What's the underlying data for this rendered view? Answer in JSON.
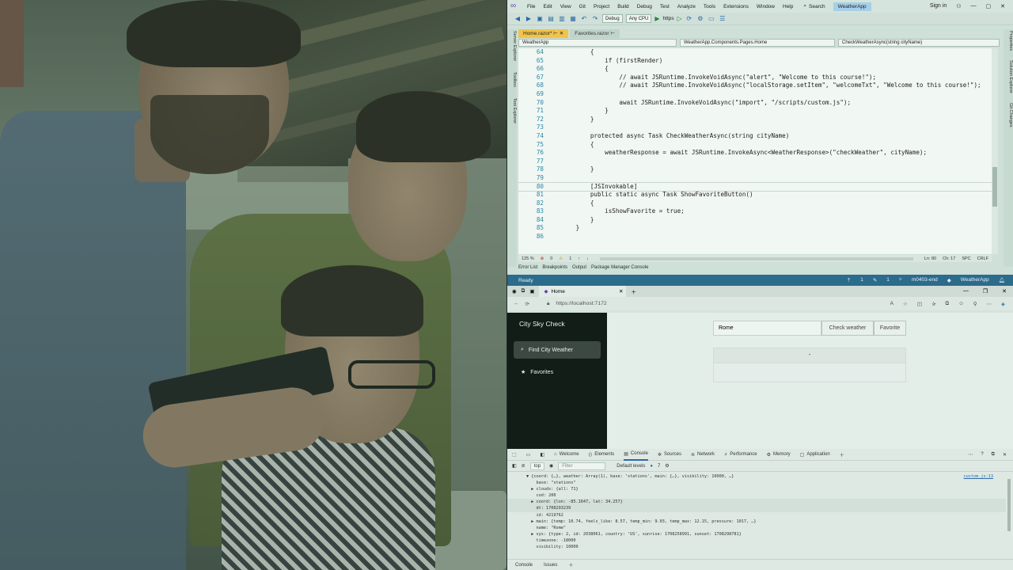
{
  "vs": {
    "menu": [
      "File",
      "Edit",
      "View",
      "Git",
      "Project",
      "Build",
      "Debug",
      "Test",
      "Analyze",
      "Tools",
      "Extensions",
      "Window",
      "Help"
    ],
    "search_label": "Search",
    "app_name": "WeatherApp",
    "sign_in": "Sign in",
    "toolbar": {
      "config": "Debug",
      "platform": "Any CPU",
      "run_target": "https"
    },
    "tabs": [
      {
        "label": "Home.razor*",
        "active": true
      },
      {
        "label": "Favorites.razor",
        "active": false
      }
    ],
    "nav": {
      "project": "WeatherApp",
      "class": "WeatherApp.Components.Pages.Home",
      "member": "CheckWeatherAsync(string cityName)"
    },
    "left_tools": [
      "Server Explorer",
      "Toolbox",
      "Test Explorer"
    ],
    "right_tools": [
      "Properties",
      "Solution Explorer",
      "Git Changes"
    ],
    "code": [
      {
        "n": "64",
        "t": "            {"
      },
      {
        "n": "65",
        "t": "                if (firstRender)"
      },
      {
        "n": "66",
        "t": "                {"
      },
      {
        "n": "67",
        "t": "                    // await JSRuntime.InvokeVoidAsync(\"alert\", \"Welcome to this course!\");"
      },
      {
        "n": "68",
        "t": "                    // await JSRuntime.InvokeVoidAsync(\"localStorage.setItem\", \"welcomeTxt\", \"Welcome to this course!\");"
      },
      {
        "n": "69",
        "t": ""
      },
      {
        "n": "70",
        "t": "                    await JSRuntime.InvokeVoidAsync(\"import\", \"/scripts/custom.js\");"
      },
      {
        "n": "71",
        "t": "                }"
      },
      {
        "n": "72",
        "t": "            }"
      },
      {
        "n": "73",
        "t": ""
      },
      {
        "n": "74",
        "t": "            protected async Task CheckWeatherAsync(string cityName)"
      },
      {
        "n": "75",
        "t": "            {"
      },
      {
        "n": "76",
        "t": "                weatherResponse = await JSRuntime.InvokeAsync<WeatherResponse>(\"checkWeather\", cityName);"
      },
      {
        "n": "77",
        "t": ""
      },
      {
        "n": "78",
        "t": "            }"
      },
      {
        "n": "79",
        "t": ""
      },
      {
        "n": "80",
        "t": "            [JSInvokable]"
      },
      {
        "n": "81",
        "t": "            public static async Task ShowFavoriteButton()"
      },
      {
        "n": "82",
        "t": "            {"
      },
      {
        "n": "83",
        "t": "                isShowFavorite = true;"
      },
      {
        "n": "84",
        "t": "            }"
      },
      {
        "n": "85",
        "t": "        }"
      },
      {
        "n": "86",
        "t": ""
      }
    ],
    "editor_status": {
      "zoom": "125 %",
      "errors": "0",
      "warnings": "1",
      "ln": "Ln: 80",
      "ch": "Ch: 17",
      "spc": "SPC",
      "eol": "CRLF"
    },
    "output_tabs": [
      "Error List",
      "Breakpoints",
      "Output",
      "Package Manager Console"
    ],
    "statusbar": {
      "left": "Ready",
      "up": "1",
      "edits": "1",
      "branch": "m0403-end",
      "repo": "WeatherApp"
    }
  },
  "browser": {
    "tab_title": "Home",
    "url": "https://localhost:7172",
    "app": {
      "title": "City Sky Check",
      "nav": [
        {
          "label": "Find City Weather",
          "icon": "search-icon",
          "active": true
        },
        {
          "label": "Favorites",
          "icon": "star-icon",
          "active": false
        }
      ],
      "city_value": "Rome",
      "check_btn": "Check weather",
      "fav_btn": "Favorite",
      "result": "-"
    },
    "devtools": {
      "tabs": [
        {
          "label": "Welcome",
          "active": false
        },
        {
          "label": "Elements",
          "active": false
        },
        {
          "label": "Console",
          "active": true
        },
        {
          "label": "Sources",
          "active": false
        },
        {
          "label": "Network",
          "active": false
        },
        {
          "label": "Performance",
          "active": false
        },
        {
          "label": "Memory",
          "active": false
        },
        {
          "label": "Application",
          "active": false
        }
      ],
      "context": "top",
      "filter_placeholder": "Filter",
      "levels": "Default levels",
      "issues_count": "7",
      "source_link": "custom.js:13",
      "lines": [
        "▼ {coord: {…}, weather: Array(1), base: 'stations', main: {…}, visibility: 10000, …}",
        "    base: \"stations\"",
        "  ▶ clouds: {all: 71}",
        "    cod: 200",
        "  ▶ coord: {lon: -85.1647, lat: 34.257}",
        "    dt: 1708293239",
        "    id: 4219762",
        "  ▶ main: {temp: 10.74, feels_like: 8.57, temp_min: 9.03, temp_max: 12.15, pressure: 1017, …}",
        "    name: \"Rome\"",
        "  ▶ sys: {type: 2, id: 2038061, country: 'US', sunrise: 1708258991, sunset: 1708298781}",
        "    timezone: -18000",
        "    visibility: 10000"
      ],
      "bottom_tabs": [
        "Console",
        "Issues"
      ]
    }
  }
}
